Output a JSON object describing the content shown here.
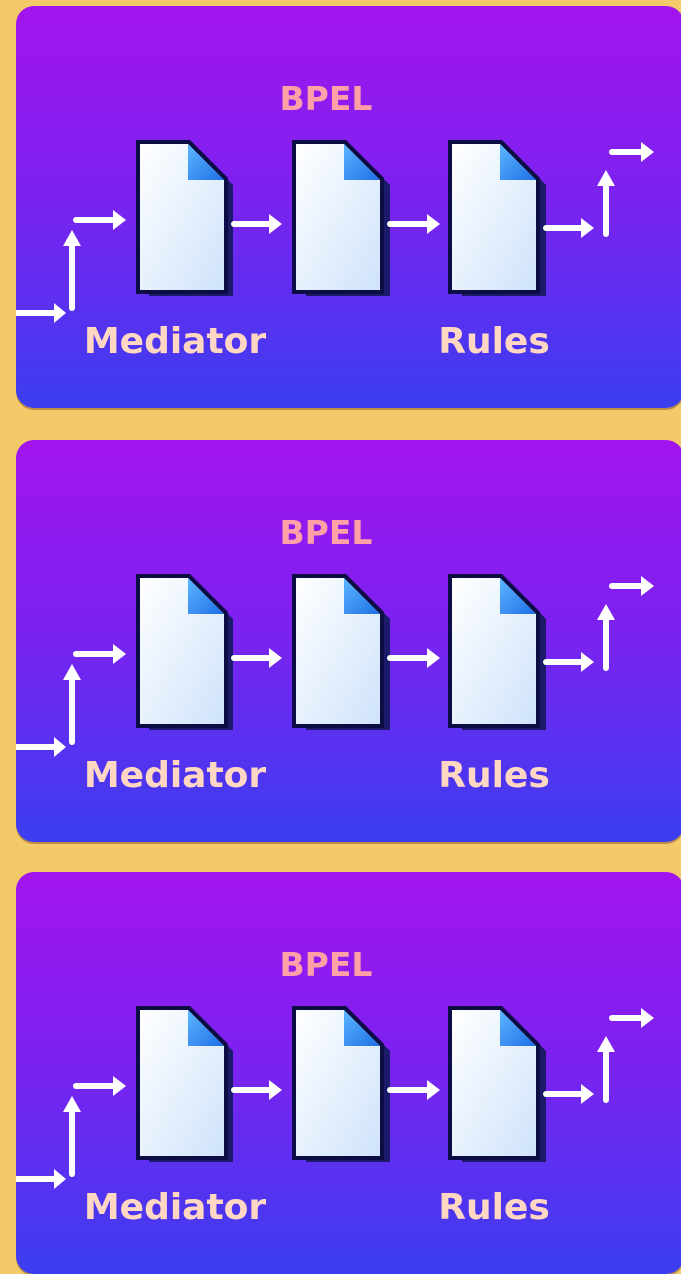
{
  "colors": {
    "outer_background": "#f3c96a",
    "panel_gradient_top": "#a214ee",
    "panel_gradient_bottom": "#3b3ef0",
    "arrow": "#ffffff",
    "document_fold": "#2f8ff5",
    "label_top": "#ffa0a8",
    "label_bottom": "#ffd7c2"
  },
  "panels": [
    {
      "labels": {
        "top": "BPEL",
        "left": "Mediator",
        "right": "Rules"
      },
      "icons": [
        "document-icon",
        "document-icon",
        "document-icon"
      ]
    },
    {
      "labels": {
        "top": "BPEL",
        "left": "Mediator",
        "right": "Rules"
      },
      "icons": [
        "document-icon",
        "document-icon",
        "document-icon"
      ]
    },
    {
      "labels": {
        "top": "BPEL",
        "left": "Mediator",
        "right": "Rules"
      },
      "icons": [
        "document-icon",
        "document-icon",
        "document-icon"
      ]
    }
  ]
}
